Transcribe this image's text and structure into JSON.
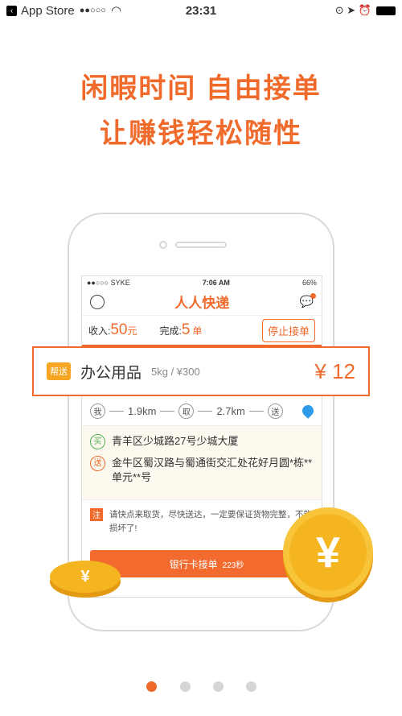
{
  "status_bar": {
    "back_app": "App Store",
    "signal": "●●○○○",
    "time": "23:31"
  },
  "headline": {
    "line1": "闲暇时间 自由接单",
    "line2": "让赚钱轻松随性"
  },
  "inner": {
    "status": {
      "carrier": "●●○○○ SYKE",
      "time": "7:06 AM",
      "battery": "66%"
    },
    "logo": "人人快递",
    "stats": {
      "income_label": "收入:",
      "income_value": "50",
      "income_unit": "元",
      "done_label": "完成:",
      "done_value": "5",
      "done_unit": "单",
      "stop_button": "停止接单"
    },
    "order": {
      "tag": "帮送",
      "title": "办公用品",
      "detail": "5kg / ¥300",
      "price": "¥ 12"
    },
    "route": {
      "me": "我",
      "dist1": "1.9km",
      "pick": "取",
      "dist2": "2.7km",
      "send": "送"
    },
    "addresses": [
      {
        "badge": "买",
        "text": "青羊区少城路27号少城大厦",
        "color": "#4caf50"
      },
      {
        "badge": "送",
        "text": "金牛区蜀汉路与蜀通街交汇处花好月圆*栋**单元**号",
        "color": "#f06a2b"
      }
    ],
    "note": {
      "badge": "注",
      "text": "请快点来取货，尽快送达，一定要保证货物完整，不能损坏了!"
    },
    "accept_button": {
      "label": "银行卡接单",
      "timer": "223秒"
    }
  },
  "coin_symbol": "¥",
  "pager": {
    "count": 4,
    "active": 0,
    "active_color": "#f06a2b"
  }
}
